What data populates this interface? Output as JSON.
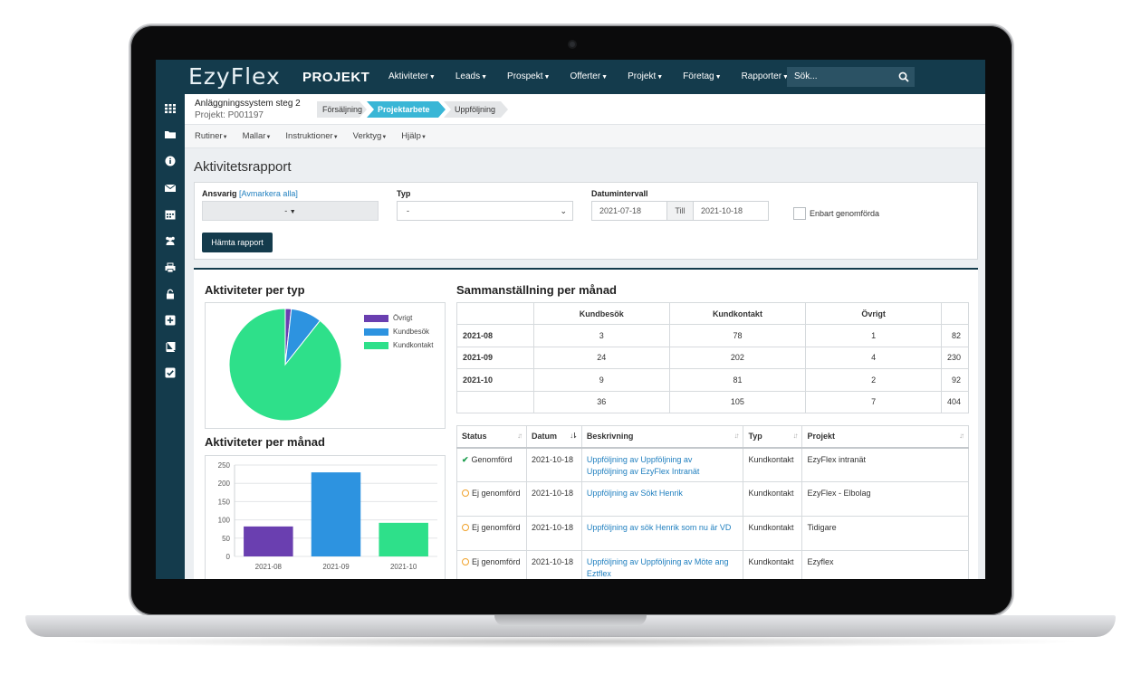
{
  "app": {
    "logo": "EzyFlex",
    "module_title": "PROJEKT",
    "nav": [
      "Aktiviteter",
      "Leads",
      "Prospekt",
      "Offerter",
      "Projekt",
      "Företag",
      "Rapporter"
    ],
    "search_placeholder": "Sök...",
    "sidebar_icons": [
      "grid-icon",
      "folder-icon",
      "info-icon",
      "mail-icon",
      "calendar-icon",
      "users-icon",
      "print-icon",
      "lock-icon",
      "plus-square-icon",
      "book-icon",
      "check-square-icon"
    ]
  },
  "project": {
    "name": "Anläggningssystem steg 2",
    "id": "Projekt: P001197",
    "stages": [
      "Försäljning",
      "Projektarbete",
      "Uppföljning"
    ],
    "active_stage": "Projektarbete"
  },
  "submenu": [
    "Rutiner",
    "Mallar",
    "Instruktioner",
    "Verktyg",
    "Hjälp"
  ],
  "page": {
    "title": "Aktivitetsrapport"
  },
  "filters": {
    "responsible_label": "Ansvarig",
    "deselect_all": "[Avmarkera alla]",
    "responsible_value": "-",
    "type_label": "Typ",
    "type_value": "-",
    "date_range_label": "Datumintervall",
    "date_from": "2021-07-18",
    "till_label": "Till",
    "date_to": "2021-10-18",
    "only_completed_label": "Enbart genomförda",
    "fetch_button": "Hämta rapport"
  },
  "pie_panel": {
    "title": "Aktiviteter per typ",
    "chart_data": {
      "type": "pie",
      "slices": [
        {
          "name": "Övrigt",
          "value": 7,
          "color": "#6a3fb0"
        },
        {
          "name": "Kundbesök",
          "value": 36,
          "color": "#2d93e0"
        },
        {
          "name": "Kundkontakt",
          "value": 361,
          "color": "#2ee08a"
        }
      ]
    }
  },
  "bar_panel": {
    "title": "Aktiviteter per månad",
    "chart_data": {
      "type": "bar",
      "categories": [
        "2021-08",
        "2021-09",
        "2021-10"
      ],
      "values": [
        82,
        230,
        92
      ],
      "colors": [
        "#6a3fb0",
        "#2d93e0",
        "#2ee08a"
      ],
      "ylim": [
        0,
        250
      ],
      "yticks": [
        "0",
        "50",
        "100",
        "150",
        "200",
        "250"
      ],
      "grid": true
    }
  },
  "summary": {
    "title": "Sammanställning per månad",
    "headers": [
      "",
      "Kundbesök",
      "Kundkontakt",
      "Övrigt",
      ""
    ],
    "rows": [
      [
        "2021-08",
        "3",
        "78",
        "1",
        "82"
      ],
      [
        "2021-09",
        "24",
        "202",
        "4",
        "230"
      ],
      [
        "2021-10",
        "9",
        "81",
        "2",
        "92"
      ],
      [
        "",
        "36",
        "105",
        "7",
        "404"
      ]
    ]
  },
  "activities": {
    "headers": [
      "Status",
      "Datum",
      "Beskrivning",
      "Typ",
      "Projekt"
    ],
    "rows": [
      {
        "status": "Genomförd",
        "done": true,
        "date": "2021-10-18",
        "desc_1": "Uppföljning av Uppföljning av",
        "desc_2": "Uppföljning av EzyFlex Intranät",
        "type": "Kundkontakt",
        "project": "EzyFlex intranät"
      },
      {
        "status": "Ej genomförd",
        "done": false,
        "date": "2021-10-18",
        "desc_1": "Uppföljning av Sökt Henrik",
        "desc_2": "",
        "type": "Kundkontakt",
        "project": "EzyFlex - Elbolag"
      },
      {
        "status": "Ej genomförd",
        "done": false,
        "date": "2021-10-18",
        "desc_1": "Uppföljning av sök Henrik som nu är VD",
        "desc_2": "",
        "type": "Kundkontakt",
        "project": "Tidigare"
      },
      {
        "status": "Ej genomförd",
        "done": false,
        "date": "2021-10-18",
        "desc_1": "Uppföljning av Uppföljning av Möte ang",
        "desc_2": "Eztflex",
        "type": "Kundkontakt",
        "project": "Ezyflex"
      }
    ]
  }
}
